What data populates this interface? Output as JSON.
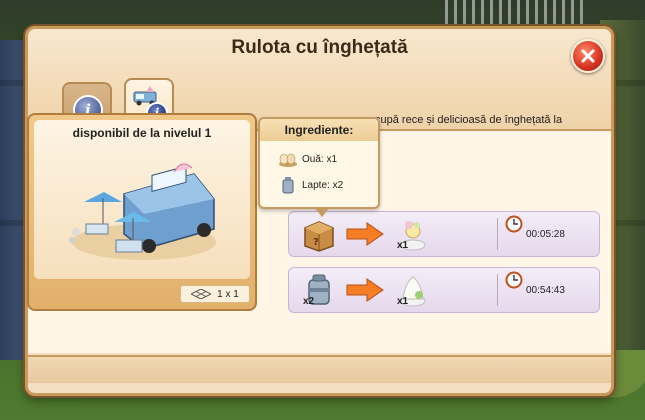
{
  "dialog": {
    "title": "Rulota cu înghețată",
    "tabs": [
      {
        "name": "info",
        "icon": "info-icon"
      },
      {
        "name": "ice-cream-truck",
        "icon": "ice-cream-truck-icon"
      }
    ]
  },
  "card": {
    "title": "disponibil de la nivelul 1",
    "size": "1 x 1"
  },
  "description": "cupă rece și delicioasă de înghețată la",
  "tooltip": {
    "title": "Ingrediente:",
    "items": [
      {
        "label": "Ouă: x1",
        "icon": "eggs-icon"
      },
      {
        "label": "Lapte: x2",
        "icon": "milk-can-icon"
      }
    ]
  },
  "recipes": [
    {
      "input_icon": "crate-icon",
      "input_qty": "",
      "output_icon": "ice-cream-icon",
      "output_qty": "x1",
      "time": "00:05:28"
    },
    {
      "input_icon": "milk-can-icon",
      "input_qty": "x2",
      "output_icon": "whipped-cream-icon",
      "output_qty": "x1",
      "time": "00:54:43"
    }
  ],
  "colors": {
    "accent": "#f5a623",
    "close": "#d6321e",
    "panel": "#f4dfc2"
  }
}
